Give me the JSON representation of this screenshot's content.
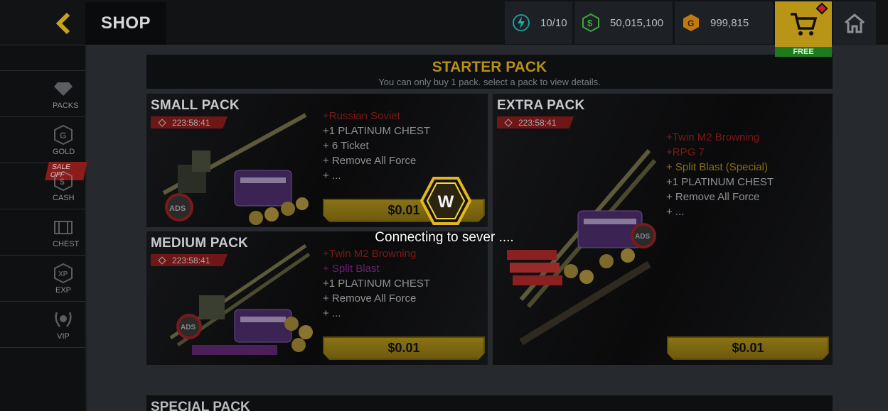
{
  "topbar": {
    "title": "SHOP",
    "energy": "10/10",
    "cash": "50,015,100",
    "gold": "999,815",
    "free_label": "FREE"
  },
  "sidebar": {
    "items": [
      {
        "label": "PACKS",
        "icon": "diamond-icon"
      },
      {
        "label": "GOLD",
        "icon": "gold-coin-icon"
      },
      {
        "label": "CASH",
        "icon": "cash-coin-icon",
        "badge": "SALE OFF"
      },
      {
        "label": "CHEST",
        "icon": "chest-icon"
      },
      {
        "label": "EXP",
        "icon": "xp-icon"
      },
      {
        "label": "VIP",
        "icon": "vip-laurel-icon"
      }
    ]
  },
  "starter": {
    "title": "STARTER PACK",
    "subtitle": "You can only buy 1 pack. select a pack to view details."
  },
  "packs": {
    "small": {
      "title": "SMALL PACK",
      "timer": "223:58:41",
      "items": [
        "+Russian Soviet",
        "+1 PLATINUM CHEST",
        "+ 6 Ticket",
        "+ Remove All Force",
        "+ ..."
      ],
      "price": "$0.01"
    },
    "medium": {
      "title": "MEDIUM PACK",
      "timer": "223:58:41",
      "items": [
        "+Twin M2 Browning",
        "+ Split Blast",
        "+1 PLATINUM CHEST",
        "+ Remove All Force",
        "+ ..."
      ],
      "price": "$0.01"
    },
    "extra": {
      "title": "EXTRA PACK",
      "timer": "223:58:41",
      "items": [
        "+Twin M2 Browning",
        "+RPG 7",
        "+ Split Blast (Special)",
        "+1 PLATINUM CHEST",
        "+ Remove All Force",
        "+ ..."
      ],
      "price": "$0.01"
    }
  },
  "special": {
    "title": "SPECIAL PACK"
  },
  "overlay": {
    "message": "Connecting to sever ....",
    "logo_letter": "W"
  },
  "colors": {
    "accent_gold": "#b99517",
    "timer_red": "#6f1616",
    "free_green": "#1e7a1e"
  }
}
